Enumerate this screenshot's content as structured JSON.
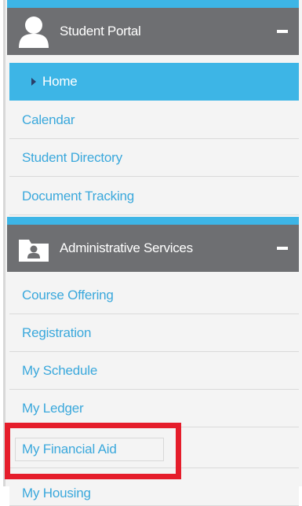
{
  "sections": [
    {
      "title": "Student Portal",
      "icon": "user-avatar-icon",
      "items": [
        {
          "label": "Home",
          "active": true
        },
        {
          "label": "Calendar"
        },
        {
          "label": "Student Directory"
        },
        {
          "label": "Document Tracking"
        }
      ]
    },
    {
      "title": "Administrative Services",
      "icon": "folder-user-icon",
      "items": [
        {
          "label": "Course Offering"
        },
        {
          "label": "Registration"
        },
        {
          "label": "My Schedule"
        },
        {
          "label": "My Ledger"
        },
        {
          "label": "My Financial Aid",
          "highlighted": true
        },
        {
          "label": "My Housing"
        }
      ]
    }
  ],
  "colors": {
    "accent": "#3db5e6",
    "header": "#6e6f72",
    "link": "#3aa8dc",
    "highlight": "#e51d2b"
  }
}
